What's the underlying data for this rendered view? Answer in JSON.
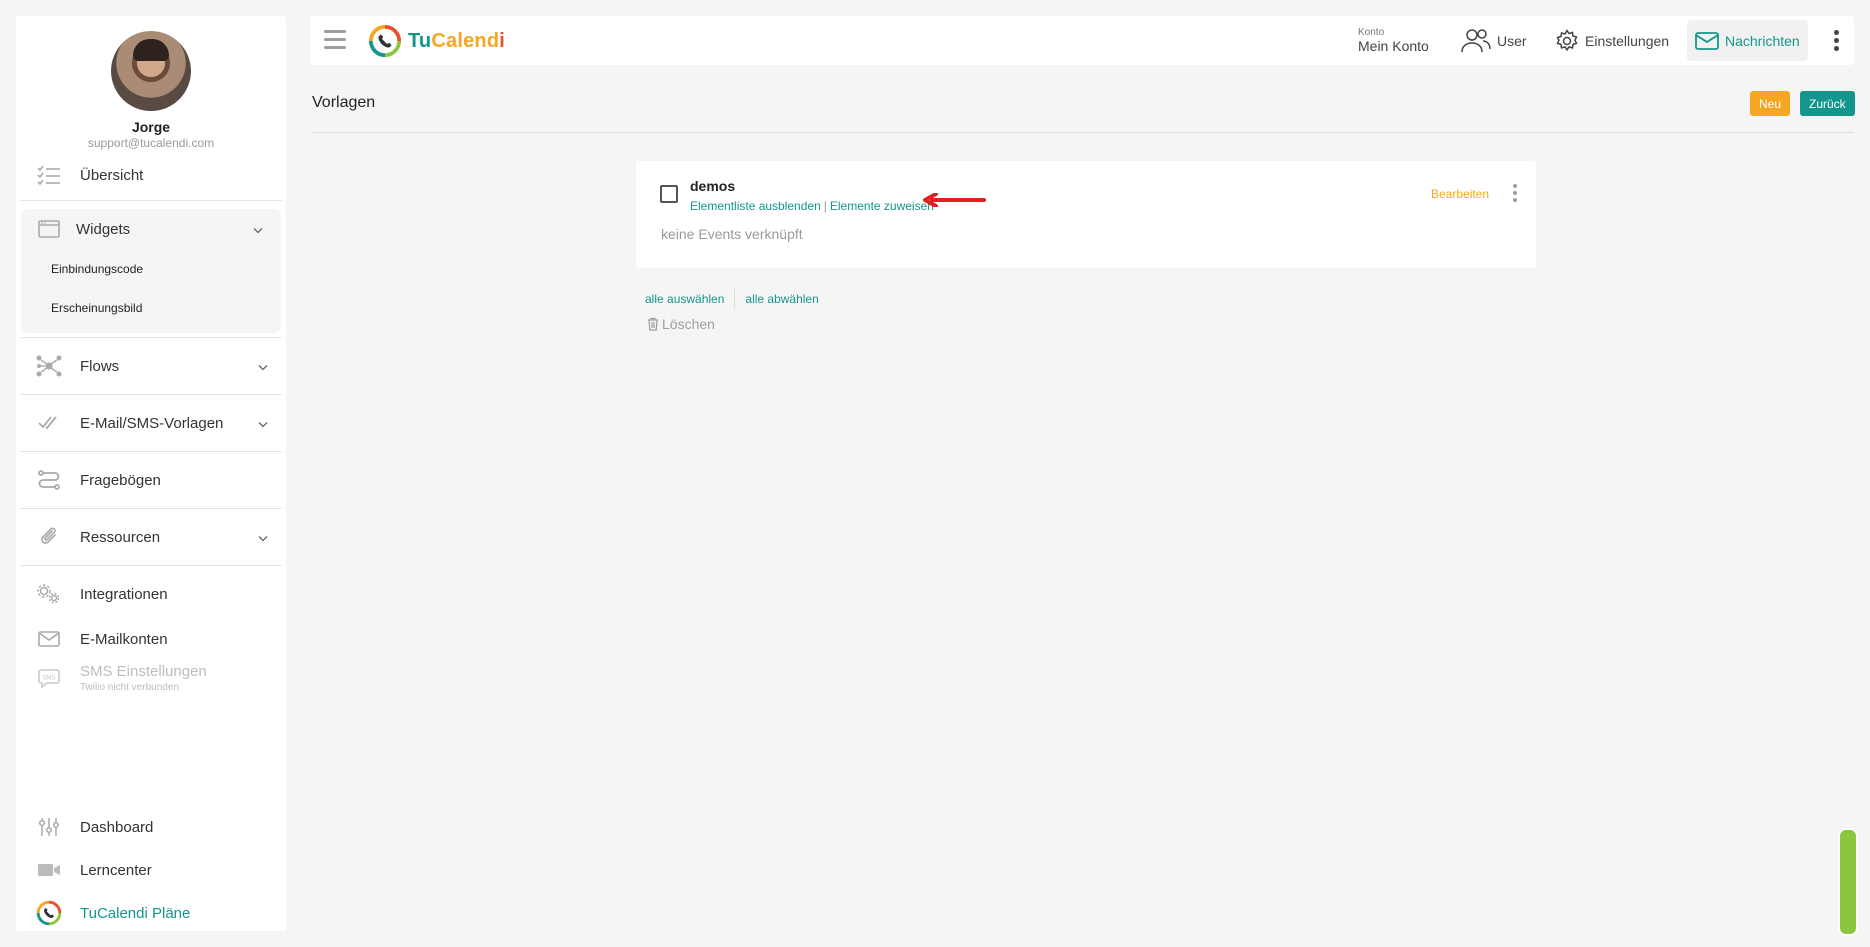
{
  "profile": {
    "name": "Jorge",
    "email": "support@tucalendi.com"
  },
  "sidebar": {
    "overview": "Übersicht",
    "widgets": "Widgets",
    "widgets_sub": [
      "Einbindungscode",
      "Erscheinungsbild"
    ],
    "flows": "Flows",
    "email_sms": "E-Mail/SMS-Vorlagen",
    "questionnaires": "Fragebögen",
    "resources": "Ressourcen",
    "integrations": "Integrationen",
    "email_accounts": "E-Mailkonten",
    "sms_settings": "SMS Einstellungen",
    "sms_note": "Twilio nicht verbunden",
    "dashboard": "Dashboard",
    "learn": "Lerncenter",
    "plans": "TuCalendi Pläne"
  },
  "topbar": {
    "logo_tu": "Tu",
    "logo_calend": "Calend",
    "logo_i": "i",
    "account_label": "Konto",
    "account_value": "Mein Konto",
    "user": "User",
    "settings": "Einstellungen",
    "messages": "Nachrichten"
  },
  "page": {
    "title": "Vorlagen",
    "new_button": "Neu",
    "back_button": "Zurück"
  },
  "card": {
    "title": "demos",
    "hide_list": "Elementliste ausblenden",
    "separator": "|",
    "assign": "Elemente zuweisen",
    "edit": "Bearbeiten",
    "empty": "keine Events verknüpft"
  },
  "actions": {
    "select_all": "alle auswählen",
    "deselect_all": "alle abwählen",
    "delete": "Löschen"
  },
  "colors": {
    "primary": "#14968c",
    "accent": "#f5a623",
    "arrow": "#e02020",
    "scroll_handle": "#8cc63f"
  }
}
